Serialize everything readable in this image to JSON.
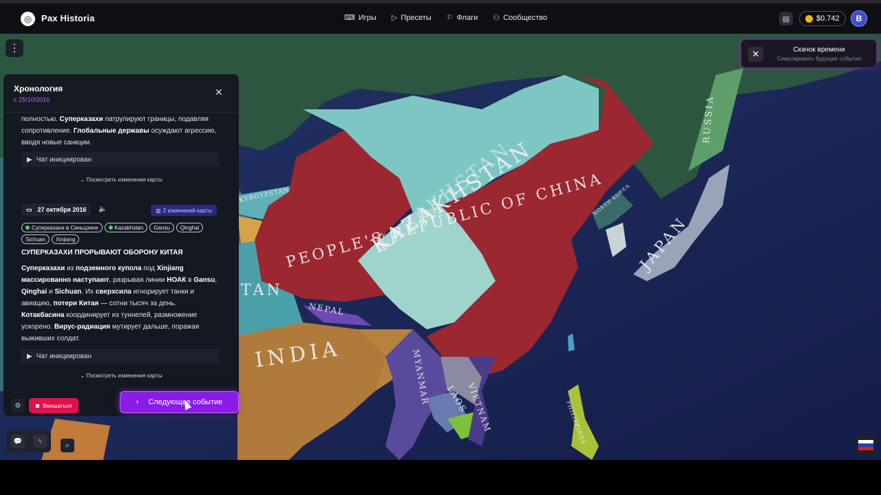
{
  "app": {
    "brand": "Pax Historia"
  },
  "nav": [
    {
      "label": "Игры",
      "icon": "gamepad-icon"
    },
    {
      "label": "Пресеты",
      "icon": "play-icon"
    },
    {
      "label": "Флаги",
      "icon": "flag-icon"
    },
    {
      "label": "Сообщество",
      "icon": "community-icon"
    }
  ],
  "header": {
    "balance": "$0.742",
    "avatar_initial": "B"
  },
  "toast": {
    "title": "Скачок времени",
    "subtitle": "Симулировать будущие события"
  },
  "timeline": {
    "title": "Хронология",
    "since": "с 25/10/2016",
    "prev_text_html": "полностью. <b>Суперказахи</b> патрулируют границы, подавляя сопротивление. <b>Глобальные державы</b> осуждают агрессию, вводя новые санкции.",
    "chat_label": "Чат инициирован",
    "map_changes_label": "Посмотреть изменения карты",
    "event": {
      "date": "27 октября 2016",
      "changes_badge": "2 изменений карты",
      "tags": [
        "Суперказахи в Синьцзяне",
        "Kazakhstan",
        "Gansu",
        "Qinghai",
        "Sichuan",
        "Xinjiang"
      ],
      "title": "СУПЕРКАЗАХИ ПРОРЫВАЮТ ОБОРОНУ КИТАЯ",
      "text_html": "<b>Суперказахи</b> из <b>подземного купола</b> под <b>Xinjiang массированно наступают</b>, разрывая линии <b>НОАК</b> в <b>Gansu</b>, <b>Qinghai</b> и <b>Sichuan</b>. Их <b>сверхсила</b> игнорирует танки и авиацию, <b>потери Китая</b> — сотни тысяч за день. <b>Котакбасина</b> координирует из туннелей, размножение ускорено. <b>Вирус-радиация</b> мутирует дальше, поражая выживших солдат."
    }
  },
  "controls": {
    "intervene": "Вмешаться",
    "next_event": "Следующее событие"
  },
  "map": {
    "labels": {
      "kazakhstan": "KAZAKHSTAN",
      "kazakhstan_sub": "KAZAKHSTAN",
      "prc": "PEOPLE'S REPUBLIC OF CHINA",
      "russia": "RUSSIA",
      "japan": "JAPAN",
      "india": "INDIA",
      "nepal": "NEPAL",
      "myanmar": "MYANMAR",
      "laos": "LAOS",
      "vietnam": "VIETNAM",
      "philippines": "PHILIPPINES",
      "north_korea": "NORTH KOREA",
      "kyrgyzstan": "KYRGYZSTAN",
      "tajikistan": "TAN"
    },
    "colors": {
      "ocean": "#1b2453",
      "china": "#9b2730",
      "kazakh": "#7ec6c4",
      "india": "#b07a3a",
      "russia_land": "#2f5a3a"
    }
  }
}
